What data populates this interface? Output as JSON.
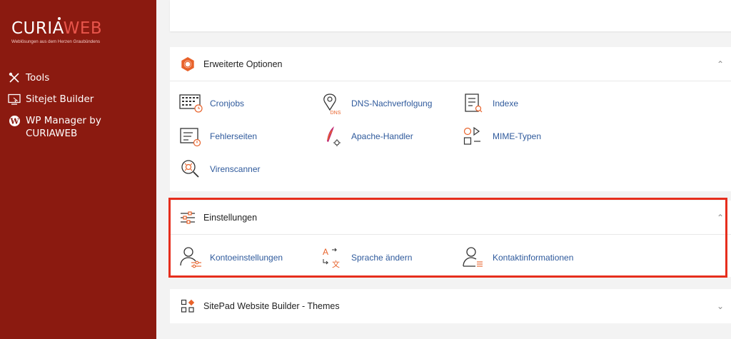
{
  "brand": {
    "logo_part1": "CURIA",
    "logo_part2": "WEB",
    "tagline": "Weblösungen aus dem Herzen Graubündens"
  },
  "sidebar": {
    "items": [
      {
        "label": "Tools",
        "icon": "tools-icon"
      },
      {
        "label": "Sitejet Builder",
        "icon": "sitejet-icon"
      },
      {
        "label": "WP Manager by CURIAWEB",
        "icon": "wordpress-icon"
      }
    ]
  },
  "sections": {
    "advanced": {
      "title": "Erweiterte Optionen",
      "icon": "gear-icon",
      "expanded": true,
      "items": [
        {
          "label": "Cronjobs",
          "icon": "cronjobs-icon"
        },
        {
          "label": "DNS-Nachverfolgung",
          "icon": "dns-icon"
        },
        {
          "label": "Indexe",
          "icon": "indexes-icon"
        },
        {
          "label": "Fehlerseiten",
          "icon": "error-pages-icon"
        },
        {
          "label": "Apache-Handler",
          "icon": "apache-icon"
        },
        {
          "label": "MIME-Typen",
          "icon": "mime-icon"
        },
        {
          "label": "Virenscanner",
          "icon": "virus-scanner-icon"
        }
      ]
    },
    "settings": {
      "title": "Einstellungen",
      "icon": "sliders-icon",
      "expanded": true,
      "items": [
        {
          "label": "Kontoeinstellungen",
          "icon": "account-settings-icon"
        },
        {
          "label": "Sprache ändern",
          "icon": "language-icon"
        },
        {
          "label": "Kontaktinformationen",
          "icon": "contact-icon"
        }
      ]
    },
    "sitepad": {
      "title": "SitePad Website Builder - Themes",
      "icon": "themes-icon",
      "expanded": false
    }
  },
  "colors": {
    "sidebar_bg": "#8b1a10",
    "accent": "#e8622a",
    "link": "#2f5a9c",
    "highlight": "#e62e1d"
  }
}
